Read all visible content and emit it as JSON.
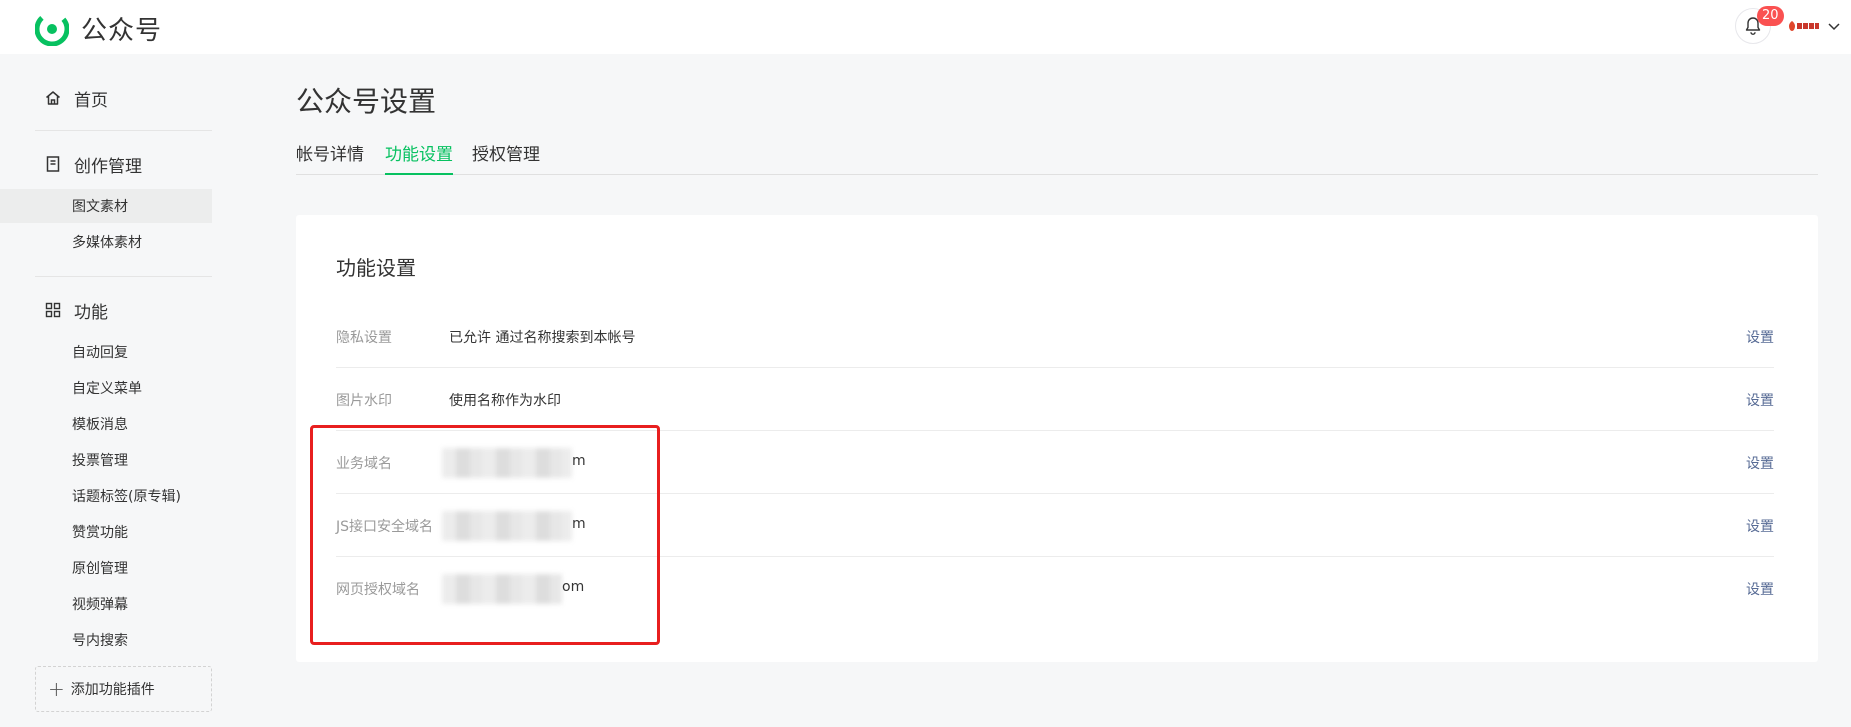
{
  "app": {
    "title": "公众号"
  },
  "header": {
    "notification_count": "20",
    "icons": [
      "logo-icon",
      "bell-icon",
      "avatar-icon",
      "chevron-down-icon"
    ]
  },
  "sidebar": {
    "home": "首页",
    "creation": {
      "label": "创作管理",
      "items": [
        "图文素材",
        "多媒体素材"
      ]
    },
    "features": {
      "label": "功能",
      "items": [
        "自动回复",
        "自定义菜单",
        "模板消息",
        "投票管理",
        "话题标签(原专辑)",
        "赞赏功能",
        "原创管理",
        "视频弹幕",
        "号内搜索"
      ]
    },
    "add_plugin": "添加功能插件"
  },
  "main": {
    "page_title": "公众号设置",
    "tabs": [
      {
        "label": "帐号详情"
      },
      {
        "label": "功能设置"
      },
      {
        "label": "授权管理"
      }
    ],
    "active_tab": "功能设置",
    "card_title": "功能设置",
    "settings": [
      {
        "label": "隐私设置",
        "value": "已允许 通过名称搜索到本帐号",
        "action": "设置"
      },
      {
        "label": "图片水印",
        "value": "使用名称作为水印",
        "action": "设置"
      },
      {
        "label": "业务域名",
        "value_tail": "m",
        "action": "设置"
      },
      {
        "label": "JS接口安全域名",
        "value_tail": "m",
        "action": "设置"
      },
      {
        "label": "网页授权域名",
        "value_tail": "om",
        "action": "设置"
      }
    ]
  },
  "colors": {
    "accent": "#07c160",
    "link": "#576b95",
    "badge": "#fa5151",
    "annotation": "#e81f1f",
    "background": "#f6f7f8"
  }
}
